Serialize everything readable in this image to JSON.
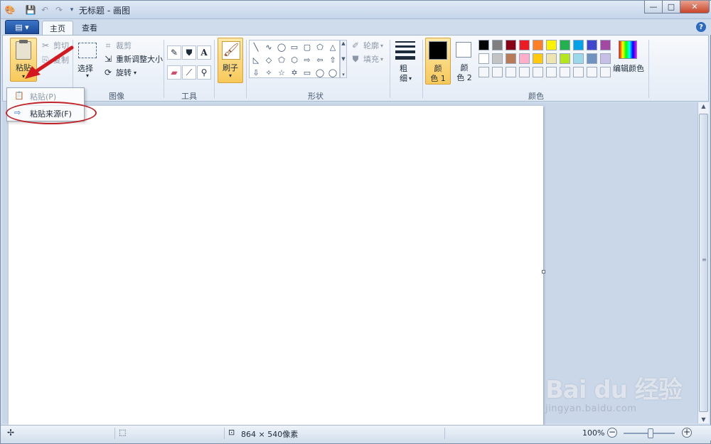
{
  "window": {
    "title": "无标题 - 画图",
    "controls": {
      "minimize": "—",
      "maximize": "□",
      "close": "✕"
    }
  },
  "tabs": {
    "file": "▤ ▾",
    "home": "主页",
    "view": "查看"
  },
  "clipboard": {
    "paste_label": "粘贴",
    "cut_label": "剪切",
    "copy_label": "复制"
  },
  "image": {
    "group_label": "图像",
    "select_label": "选择",
    "crop_label": "裁剪",
    "resize_label": "重新调整大小",
    "rotate_label": "旋转"
  },
  "tools": {
    "group_label": "工具",
    "text_tool": "A"
  },
  "brushes": {
    "label": "刷子"
  },
  "shapes": {
    "group_label": "形状",
    "outline_label": "轮廓",
    "fill_label": "填充",
    "glyphs": [
      "╲",
      "∿",
      "◯",
      "▭",
      "▢",
      "⬠",
      "△",
      "◺",
      "◇",
      "⬠",
      "⬡",
      "⇨",
      "⇦",
      "⇧",
      "⇩",
      "✧",
      "☆",
      "✡",
      "▭",
      "◯",
      "◯"
    ]
  },
  "size": {
    "label_line1": "粗",
    "label_line2": "细"
  },
  "colors": {
    "group_label": "颜色",
    "color1_label_line1": "颜",
    "color1_label_line2": "色 1",
    "color2_label_line1": "颜",
    "color2_label_line2": "色 2",
    "color1": "#000000",
    "color2": "#ffffff",
    "edit_label": "编辑颜色",
    "palette_row1": [
      "#000000",
      "#7f7f7f",
      "#880015",
      "#ed1c24",
      "#ff7f27",
      "#fff200",
      "#22b14c",
      "#00a2e8",
      "#3f48cc",
      "#a349a4"
    ],
    "palette_row2": [
      "#ffffff",
      "#c3c3c3",
      "#b97a57",
      "#ffaec9",
      "#ffc90e",
      "#efe4b0",
      "#b5e61d",
      "#99d9ea",
      "#7092be",
      "#c8bfe7"
    ]
  },
  "paste_menu": {
    "item1": "粘贴(P)",
    "item2": "粘贴来源(F)"
  },
  "statusbar": {
    "dimensions": "864 × 540像素",
    "zoom": "100%"
  },
  "watermark": {
    "logo": "Bai du 经验",
    "url": "jingyan.baidu.com"
  }
}
